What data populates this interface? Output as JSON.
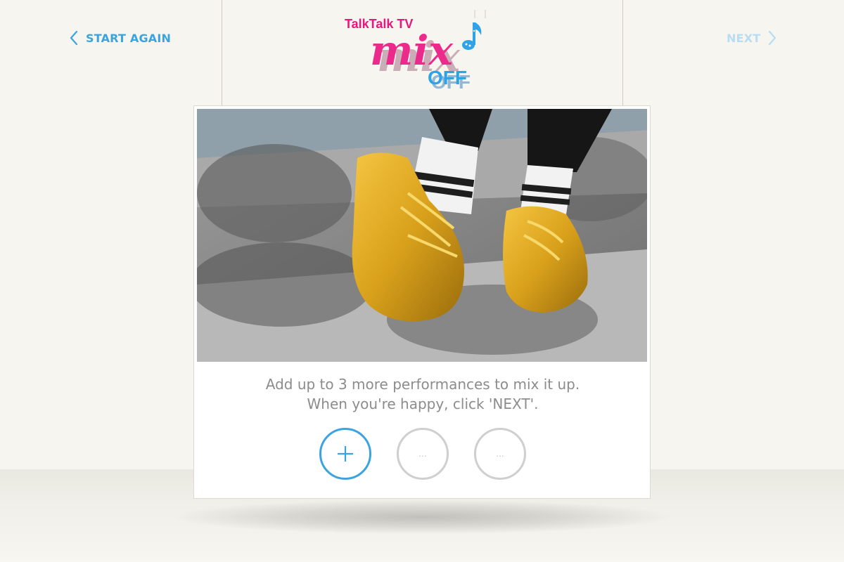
{
  "nav": {
    "start_again_label": "START AGAIN",
    "next_label": "NEXT"
  },
  "logo": {
    "brand": "TalkTalk TV",
    "title_main": "mix",
    "title_sub": "OFF"
  },
  "instructions": {
    "line1": "Add up to 3 more performances to mix it up.",
    "line2": "When you're happy, click 'NEXT'."
  },
  "slots": [
    {
      "state": "add",
      "symbol": "+"
    },
    {
      "state": "empty",
      "symbol": "..."
    },
    {
      "state": "empty",
      "symbol": "..."
    }
  ],
  "colors": {
    "accent": "#3ba4df",
    "next_disabled": "#b8dcf1",
    "background": "#f6f5ef",
    "brand_pink": "#e8177d",
    "text_grey": "#8c8c8c"
  },
  "icons": {
    "back": "chevron-left-icon",
    "forward": "chevron-right-icon",
    "add": "plus-icon",
    "note": "music-note-icon"
  }
}
